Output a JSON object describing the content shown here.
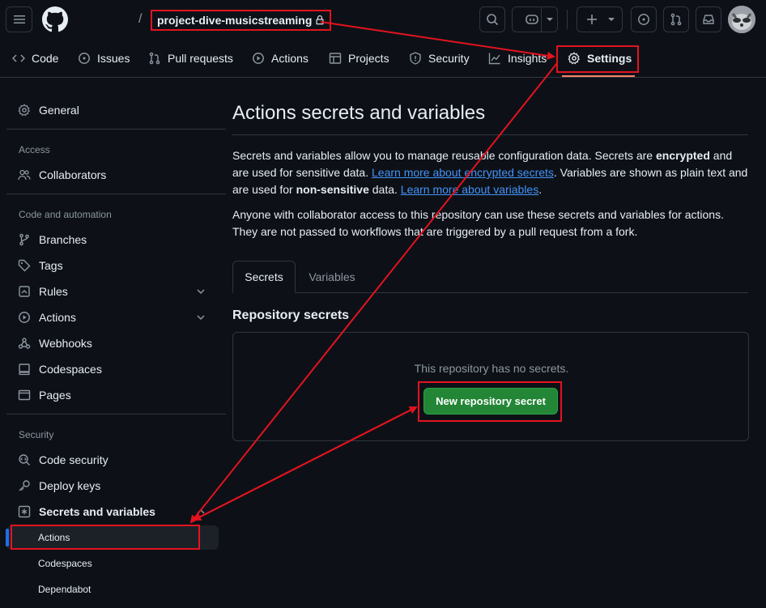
{
  "header": {
    "repo_name": "project-dive-musicstreaming",
    "slash": "/"
  },
  "repo_nav": {
    "items": [
      {
        "label": "Code",
        "icon": "code-icon"
      },
      {
        "label": "Issues",
        "icon": "issue-icon"
      },
      {
        "label": "Pull requests",
        "icon": "pull-request-icon"
      },
      {
        "label": "Actions",
        "icon": "play-icon"
      },
      {
        "label": "Projects",
        "icon": "table-icon"
      },
      {
        "label": "Security",
        "icon": "shield-icon"
      },
      {
        "label": "Insights",
        "icon": "graph-icon"
      },
      {
        "label": "Settings",
        "icon": "gear-icon"
      }
    ]
  },
  "sidebar": {
    "general": "General",
    "access_heading": "Access",
    "collaborators": "Collaborators",
    "code_heading": "Code and automation",
    "branches": "Branches",
    "tags": "Tags",
    "rules": "Rules",
    "actions": "Actions",
    "webhooks": "Webhooks",
    "codespaces": "Codespaces",
    "pages": "Pages",
    "security_heading": "Security",
    "code_security": "Code security",
    "deploy_keys": "Deploy keys",
    "secrets_and_variables": "Secrets and variables",
    "sub_items": [
      "Actions",
      "Codespaces",
      "Dependabot"
    ]
  },
  "main": {
    "title": "Actions secrets and variables",
    "para1": {
      "t1": "Secrets and variables allow you to manage reusable configuration data. Secrets are ",
      "b1": "encrypted",
      "t2": " and are used for sensitive data. ",
      "link1": "Learn more about encrypted secrets",
      "t3": ". Variables are shown as plain text and are used for ",
      "b2": "non-sensitive",
      "t4": " data. ",
      "link2": "Learn more about variables",
      "t5": "."
    },
    "para2": "Anyone with collaborator access to this repository can use these secrets and variables for actions. They are not passed to workflows that are triggered by a pull request from a fork.",
    "tabs": [
      "Secrets",
      "Variables"
    ],
    "section_title": "Repository secrets",
    "empty_message": "This repository has no secrets.",
    "new_secret_button": "New repository secret"
  },
  "colors": {
    "background": "#0d1117",
    "accent_green": "#238636",
    "annotation_red": "#e3131f",
    "link_blue": "#4493f8"
  }
}
